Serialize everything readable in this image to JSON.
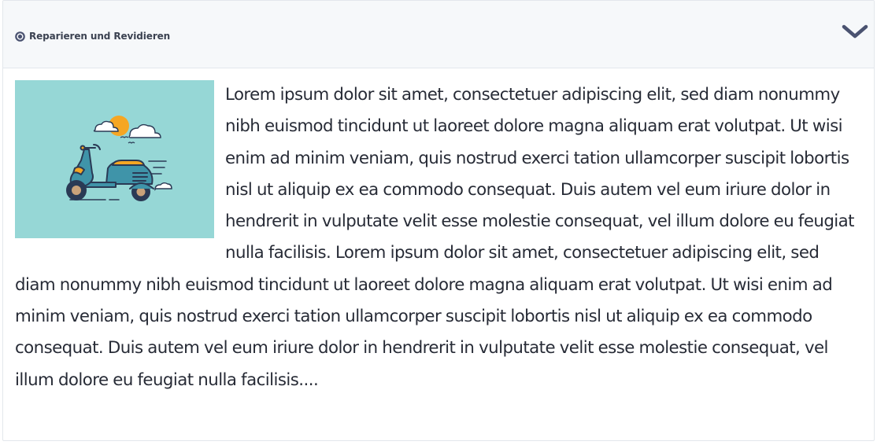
{
  "accordion": {
    "title": "Reparieren und Revidieren",
    "title_icon": "target-icon",
    "toggle_icon": "chevron-down-icon",
    "expanded": true
  },
  "content": {
    "image_subject": "scooter-illustration",
    "text": "Lorem ipsum dolor sit amet, consectetuer adipiscing elit, sed diam nonummy nibh euismod tincidunt ut laoreet dolore magna aliquam erat volutpat. Ut wisi enim ad minim veniam, quis nostrud exerci tation ullamcorper suscipit lobortis nisl ut aliquip ex ea commodo consequat. Duis autem vel eum iriure dolor in hendrerit in vulputate velit esse molestie consequat, vel illum dolore eu feugiat nulla facilisis. Lorem ipsum dolor sit amet, consectetuer adipiscing elit, sed diam nonummy nibh euismod tincidunt ut laoreet dolore magna aliquam erat volutpat. Ut wisi enim ad minim veniam, quis nostrud exerci tation ullamcorper suscipit lobortis nisl ut aliquip ex ea commodo consequat. Duis autem vel eum iriure dolor in hendrerit in vulputate velit esse molestie consequat, vel illum dolore eu feugiat nulla facilisis...."
  },
  "colors": {
    "header_bg": "#f6f8fa",
    "border": "#e3e7ec",
    "title_text": "#3b4251",
    "chevron": "#4a5270",
    "body_text": "#272b36",
    "thumb_bg": "#96d7d6"
  }
}
